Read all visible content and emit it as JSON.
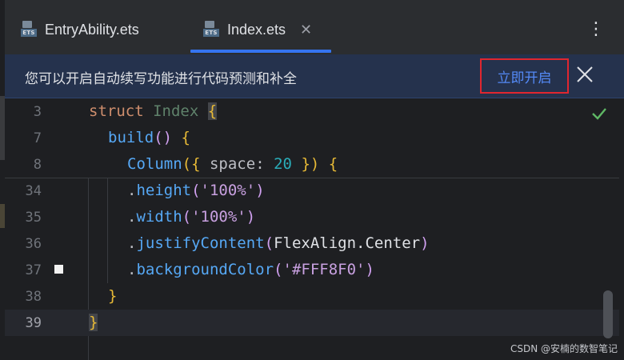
{
  "tabs": [
    {
      "label": "EntryAbility.ets",
      "icon": "ets-file-icon",
      "active": false
    },
    {
      "label": "Index.ets",
      "icon": "ets-file-icon",
      "active": true
    }
  ],
  "tab_icon_text": "ETS",
  "tab_close_glyph": "✕",
  "kebab_glyph": "⋮",
  "banner": {
    "message": "您可以开启自动续写功能进行代码预测和补全",
    "action_label": "立即开启",
    "close_icon": "close-icon"
  },
  "editor": {
    "lines": [
      {
        "num": "3"
      },
      {
        "num": "7"
      },
      {
        "num": "8"
      },
      {
        "num": "34"
      },
      {
        "num": "35"
      },
      {
        "num": "36"
      },
      {
        "num": "37"
      },
      {
        "num": "38"
      },
      {
        "num": "39"
      }
    ],
    "code": {
      "l3_kw": "struct",
      "l3_name": "Index",
      "l3_brace": "{",
      "l7_fn": "build",
      "l7_parens": "()",
      "l7_brace": "{",
      "l8_fn": "Column",
      "l8_open": "({",
      "l8_field": "space",
      "l8_colon": ":",
      "l8_num": "20",
      "l8_close": "})",
      "l8_brace": "{",
      "l34_dot": ".",
      "l34_fn": "height",
      "l34_open": "(",
      "l34_str": "'100%'",
      "l34_close": ")",
      "l35_dot": ".",
      "l35_fn": "width",
      "l35_open": "(",
      "l35_str": "'100%'",
      "l35_close": ")",
      "l36_dot": ".",
      "l36_fn": "justifyContent",
      "l36_open": "(",
      "l36_arg": "FlexAlign.Center",
      "l36_close": ")",
      "l37_dot": ".",
      "l37_fn": "backgroundColor",
      "l37_open": "(",
      "l37_str": "'#FFF8F0'",
      "l37_close": ")",
      "l38_brace": "}",
      "l39_brace": "}"
    },
    "status_icon": "checkmark-icon"
  },
  "watermark": "CSDN @安楠的数智笔记",
  "colors": {
    "accent": "#3574f0",
    "highlight_border": "#e0262f",
    "banner_bg": "#25324d",
    "editor_bg": "#1e1f22",
    "check": "#5fb865"
  }
}
